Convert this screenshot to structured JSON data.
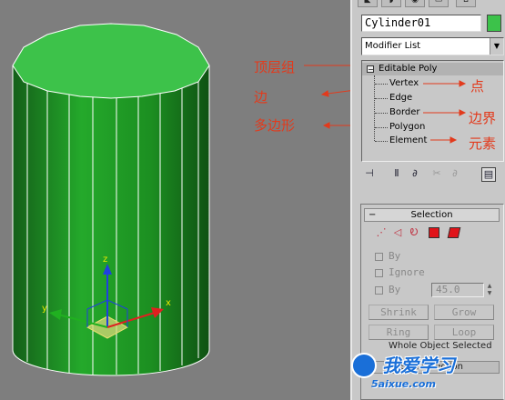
{
  "viewport": {
    "axis_labels": {
      "x": "x",
      "y": "y",
      "z": "z"
    },
    "annotations": {
      "top_face": "顶层组",
      "edge": "边",
      "polygon": "多边形",
      "vertex": "点",
      "border": "边界",
      "element": "元素"
    }
  },
  "panel": {
    "object_name": "Cylinder01",
    "object_color": "#3cc24a",
    "modifier_list": "Modifier List",
    "stack": {
      "root": "Editable Poly",
      "items": [
        "Vertex",
        "Edge",
        "Border",
        "Polygon",
        "Element"
      ]
    },
    "selection": {
      "title": "Selection",
      "by_vertex": "By",
      "ignore_backfacing": "Ignore",
      "by_angle": "By",
      "angle_value": "45.0",
      "shrink": "Shrink",
      "grow": "Grow",
      "ring": "Ring",
      "loop": "Loop",
      "whole_object": "Whole Object Selected",
      "soft_selection": "Soft Selection"
    }
  },
  "watermark": {
    "text": "我爱学习",
    "url": "5aixue.com"
  },
  "colors": {
    "cylinder_top": "#3dc24a",
    "cylinder_side": "#1e9a24",
    "annotation": "#e23a1c",
    "accent_red": "#e0141a"
  }
}
